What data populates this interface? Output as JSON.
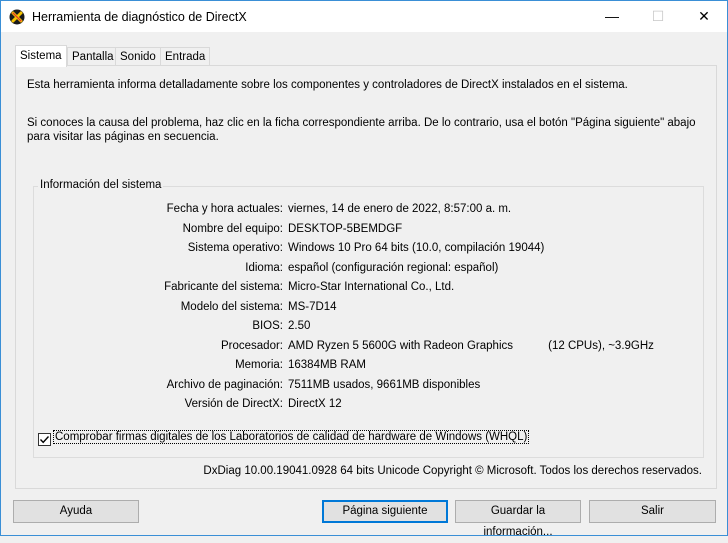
{
  "window": {
    "title": "Herramienta de diagnóstico de DirectX",
    "minimize_glyph": "—",
    "maximize_glyph": "☐",
    "close_glyph": "✕"
  },
  "tabs": [
    {
      "label": "Sistema"
    },
    {
      "label": "Pantalla"
    },
    {
      "label": "Sonido"
    },
    {
      "label": "Entrada"
    }
  ],
  "intro": {
    "line1": "Esta herramienta informa detalladamente sobre los componentes y controladores de DirectX instalados en el sistema.",
    "line2": "Si conoces la causa del problema, haz clic en la ficha correspondiente arriba. De lo contrario, usa el botón \"Página siguiente\" abajo para visitar las páginas en secuencia."
  },
  "system_info": {
    "legend": "Información del sistema",
    "rows": [
      {
        "label": "Fecha y hora actuales:",
        "value": "viernes, 14 de enero de 2022, 8:57:00 a. m."
      },
      {
        "label": "Nombre del equipo:",
        "value": "DESKTOP-5BEMDGF"
      },
      {
        "label": "Sistema operativo:",
        "value": "Windows 10 Pro 64 bits (10.0, compilación 19044)"
      },
      {
        "label": "Idioma:",
        "value": "español (configuración regional: español)"
      },
      {
        "label": "Fabricante del sistema:",
        "value": "Micro-Star International Co., Ltd."
      },
      {
        "label": "Modelo del sistema:",
        "value": "MS-7D14"
      },
      {
        "label": "BIOS:",
        "value": "2.50"
      },
      {
        "label": "Procesador:",
        "value": "AMD Ryzen 5 5600G with Radeon Graphics           (12 CPUs), ~3.9GHz"
      },
      {
        "label": "Memoria:",
        "value": "16384MB RAM"
      },
      {
        "label": "Archivo de paginación:",
        "value": "7511MB usados, 9661MB disponibles"
      },
      {
        "label": "Versión de DirectX:",
        "value": "DirectX 12"
      }
    ]
  },
  "whql_checkbox": {
    "label": "Comprobar firmas digitales de los Laboratorios de calidad de hardware de Windows (WHQL)",
    "checked": true
  },
  "footer_info": "DxDiag 10.00.19041.0928 64 bits Unicode  Copyright © Microsoft. Todos los derechos reservados.",
  "buttons": {
    "help": "Ayuda",
    "next": "Página siguiente",
    "save": "Guardar la información...",
    "exit": "Salir"
  },
  "colors": {
    "accent": "#0078d7",
    "window_border": "#3a8fd6",
    "background": "#f0f0f0"
  }
}
